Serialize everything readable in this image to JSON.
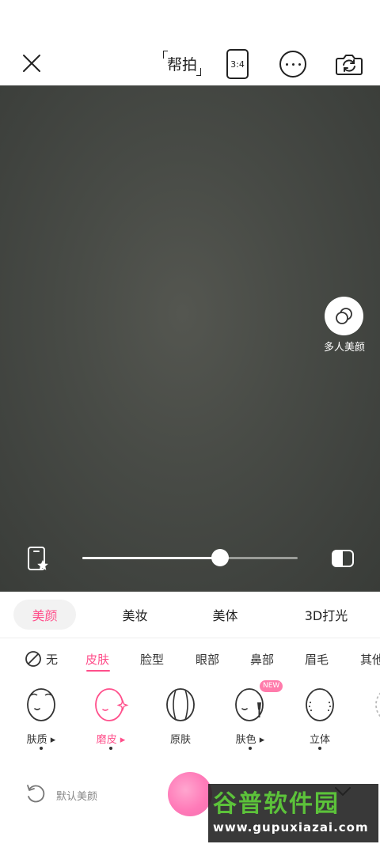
{
  "topbar": {
    "close_icon": "close-icon",
    "helper_label": "帮拍",
    "ratio_label": "3:4",
    "more_icon": "more-icon",
    "flip_icon": "camera-flip-icon"
  },
  "camera": {
    "multi_face_label": "多人美颜",
    "slider_value_percent": 64
  },
  "categories": [
    {
      "label": "美颜",
      "active": true
    },
    {
      "label": "美妆",
      "active": false
    },
    {
      "label": "美体",
      "active": false
    },
    {
      "label": "3D打光",
      "active": false
    }
  ],
  "sub_tabs": [
    {
      "label": "无"
    },
    {
      "label": "皮肤",
      "active": true
    },
    {
      "label": "脸型"
    },
    {
      "label": "眼部"
    },
    {
      "label": "鼻部"
    },
    {
      "label": "眉毛"
    },
    {
      "label": "其他"
    }
  ],
  "items": [
    {
      "label": "肤质",
      "has_arrow": true,
      "dot": true
    },
    {
      "label": "磨皮",
      "has_arrow": true,
      "dot": true,
      "active": true
    },
    {
      "label": "原肤",
      "has_arrow": false,
      "dot": false
    },
    {
      "label": "肤色",
      "has_arrow": true,
      "dot": true,
      "badge": "NEW"
    },
    {
      "label": "立体",
      "has_arrow": false,
      "dot": true
    }
  ],
  "bottom": {
    "reset_label": "默认美颜"
  },
  "watermark": {
    "main": "谷普软件园",
    "url": "www.gupuxiazai.com"
  },
  "colors": {
    "accent": "#ff4f8b",
    "shutter": "#ff7ab8",
    "watermark_green": "#5cc23a"
  }
}
